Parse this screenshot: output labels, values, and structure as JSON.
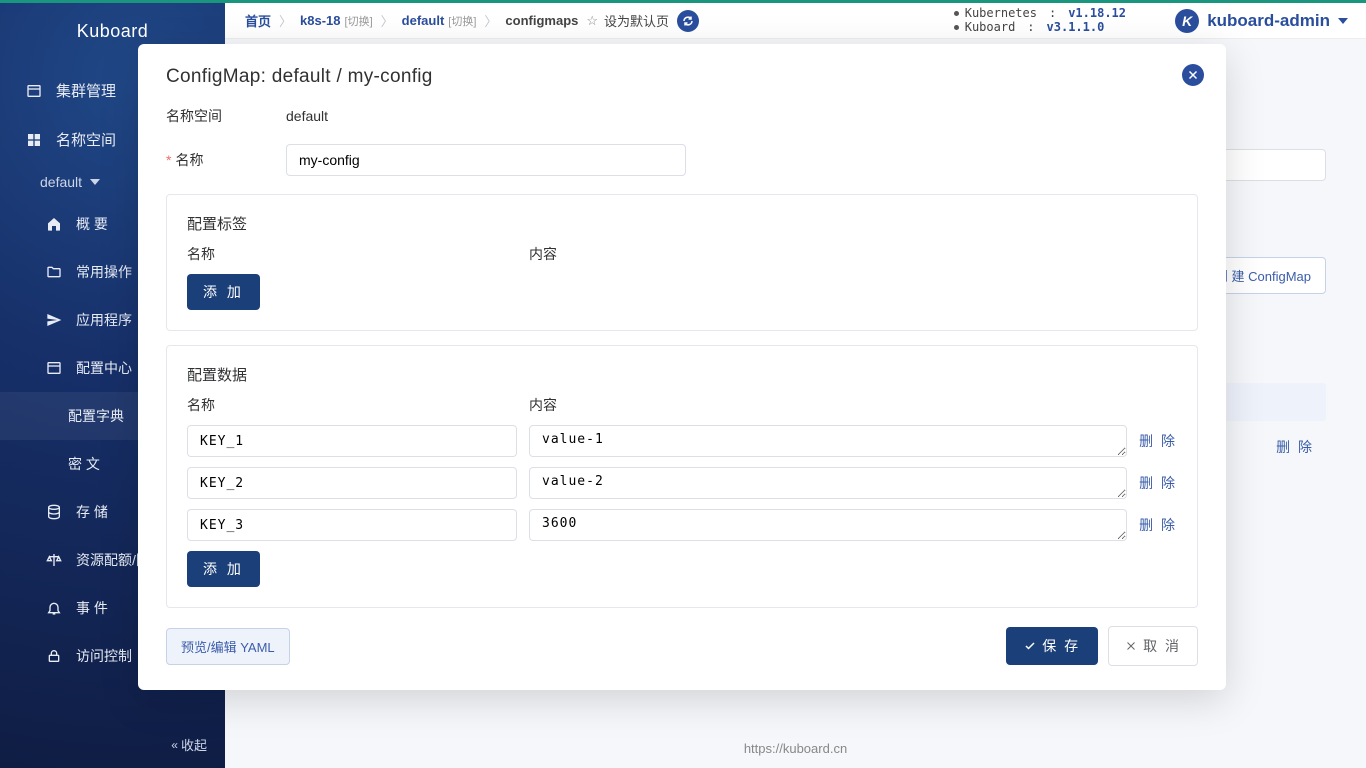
{
  "brand": "Kuboard",
  "sidebar": {
    "cluster_mgmt": "集群管理",
    "namespace": "名称空间",
    "ns_selected": "default",
    "items": [
      {
        "label": "概 要"
      },
      {
        "label": "常用操作"
      },
      {
        "label": "应用程序"
      },
      {
        "label": "配置中心"
      },
      {
        "label": "配置字典"
      },
      {
        "label": "密 文"
      },
      {
        "label": "存 储"
      },
      {
        "label": "资源配额/限制"
      },
      {
        "label": "事 件"
      },
      {
        "label": "访问控制"
      }
    ],
    "collapse": "收起"
  },
  "breadcrumb": {
    "home": "首页",
    "cluster": "k8s-18",
    "cluster_tag": "[切换]",
    "ns": "default",
    "ns_tag": "[切换]",
    "res": "configmaps",
    "set_default": "设为默认页"
  },
  "cluster_info": {
    "k8s_label": "Kubernetes",
    "k8s_ver": "v1.18.12",
    "kb_label": "Kuboard",
    "kb_ver": "v3.1.1.0"
  },
  "user": {
    "name": "kuboard-admin",
    "initial": "K"
  },
  "background": {
    "create_btn": "创 建 ConfigMap",
    "delete": "删 除"
  },
  "footer_url": "https://kuboard.cn",
  "modal": {
    "title": "ConfigMap: default / my-config",
    "labels": {
      "namespace": "名称空间",
      "name": "名称",
      "section_labels": "配置标签",
      "section_data": "配置数据",
      "col_name": "名称",
      "col_content": "内容",
      "add": "添 加",
      "delete": "删 除",
      "yaml": "预览/编辑 YAML",
      "save": "保 存",
      "cancel": "取 消"
    },
    "namespace_value": "default",
    "name_value": "my-config",
    "data_rows": [
      {
        "key": "KEY_1",
        "value": "value-1"
      },
      {
        "key": "KEY_2",
        "value": "value-2"
      },
      {
        "key": "KEY_3",
        "value": "3600"
      }
    ]
  }
}
